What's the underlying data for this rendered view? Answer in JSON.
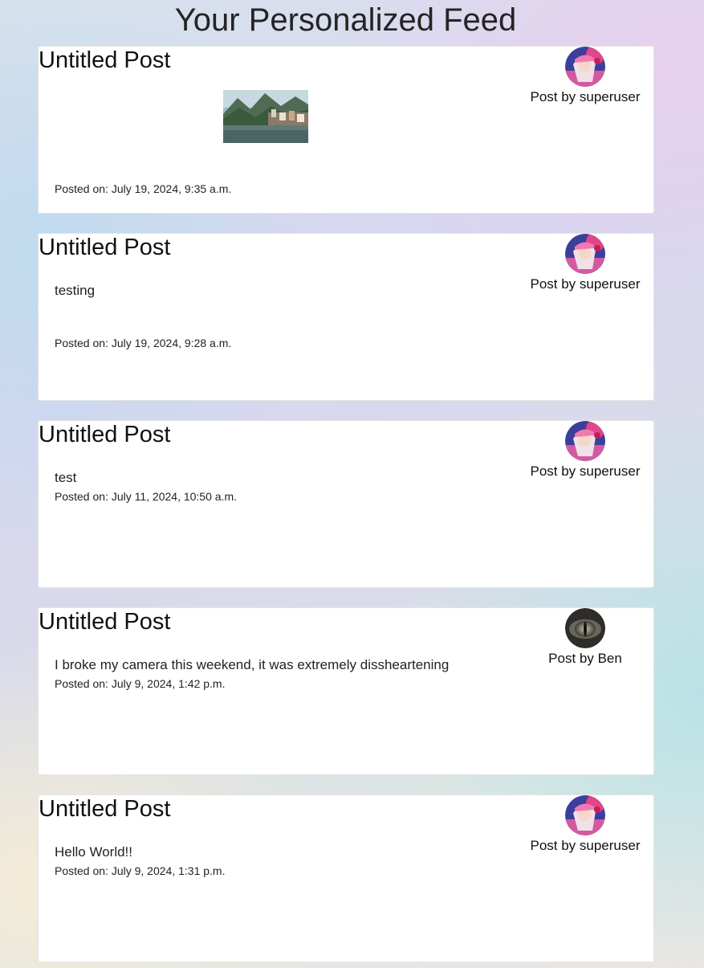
{
  "page": {
    "title": "Your Personalized Feed"
  },
  "posts": [
    {
      "title": "Untitled Post",
      "author": "Post by superuser",
      "avatar_icon": "anime-character-avatar",
      "body": "",
      "image": "lakeside-village-mountain-photo",
      "date": "Posted on: July 19, 2024, 9:35 a.m."
    },
    {
      "title": "Untitled Post",
      "author": "Post by superuser",
      "avatar_icon": "anime-character-avatar",
      "body": "testing",
      "date": "Posted on: July 19, 2024, 9:28 a.m."
    },
    {
      "title": "Untitled Post",
      "author": "Post by superuser",
      "avatar_icon": "anime-character-avatar",
      "body": "test",
      "date": "Posted on: July 11, 2024, 10:50 a.m."
    },
    {
      "title": "Untitled Post",
      "author": "Post by Ben",
      "avatar_icon": "reptile-eye-avatar",
      "body": "I broke my camera this weekend, it was extremely dissheartening",
      "date": "Posted on: July 9, 2024, 1:42 p.m."
    },
    {
      "title": "Untitled Post",
      "author": "Post by superuser",
      "avatar_icon": "anime-character-avatar",
      "body": "Hello World!!",
      "date": "Posted on: July 9, 2024, 1:31 p.m."
    }
  ],
  "colors": {
    "card_background": "#ffffff",
    "text": "#222222"
  }
}
